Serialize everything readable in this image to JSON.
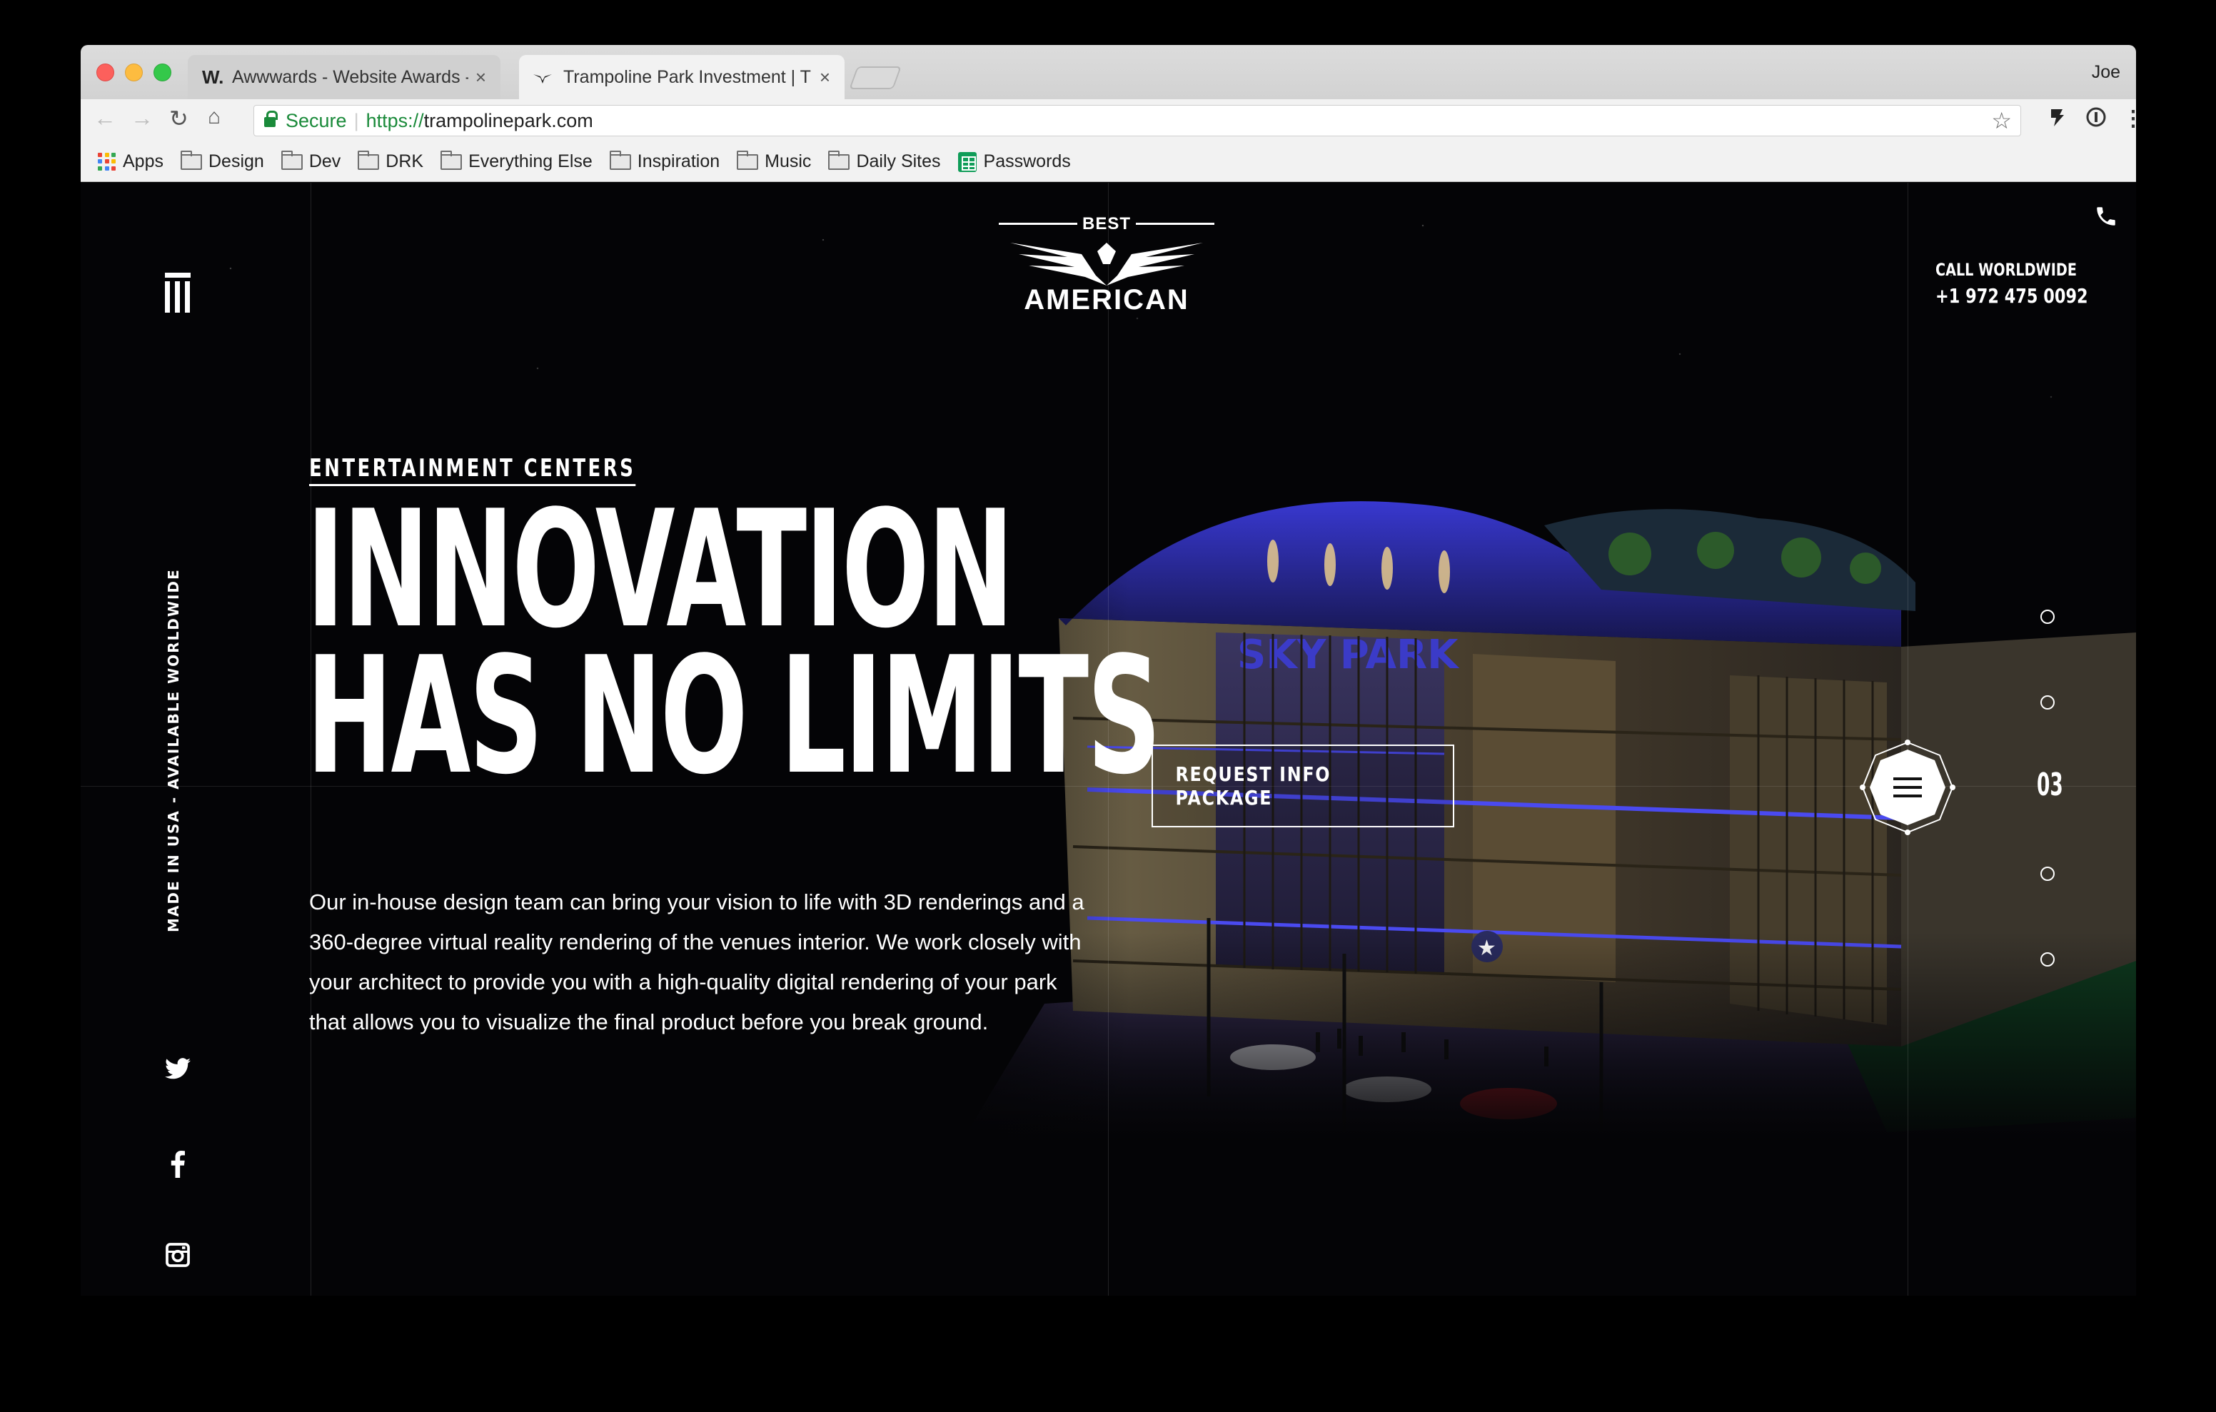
{
  "browser": {
    "tabs": [
      {
        "favicon": "W.",
        "title": "Awwwards - Website Awards -",
        "close": "×"
      },
      {
        "favicon": "eagle-icon",
        "title": "Trampoline Park Investment | T",
        "close": "×"
      }
    ],
    "profile": "Joe",
    "address": {
      "secure_label": "Secure",
      "scheme": "https://",
      "host": "trampolinepark.com"
    },
    "bookmarks": [
      {
        "label": "Apps",
        "icon": "apps-grid-icon"
      },
      {
        "label": "Design",
        "icon": "folder-icon"
      },
      {
        "label": "Dev",
        "icon": "folder-icon"
      },
      {
        "label": "DRK",
        "icon": "folder-icon"
      },
      {
        "label": "Everything Else",
        "icon": "folder-icon"
      },
      {
        "label": "Inspiration",
        "icon": "folder-icon"
      },
      {
        "label": "Music",
        "icon": "folder-icon"
      },
      {
        "label": "Daily Sites",
        "icon": "folder-icon"
      },
      {
        "label": "Passwords",
        "icon": "sheets-icon"
      }
    ]
  },
  "site": {
    "logo": {
      "top": "BEST",
      "name": "AMERICAN"
    },
    "side_text": "MADE IN USA - AVAILABLE WORLDWIDE",
    "eyebrow": "ENTERTAINMENT CENTERS",
    "headline": {
      "line1": "INNOVATION",
      "line2": "HAS NO LIMITS"
    },
    "body": "Our in-house design team can bring your vision to life with 3D renderings and a 360-degree virtual reality rendering of the venues interior. We work closely with your architect to provide you with a high-quality digital rendering of your park that allows you to visualize the final product before you break ground.",
    "cta": "REQUEST INFO PACKAGE",
    "call_label": "CALL WORLDWIDE",
    "call_number": "+1 972 475 0092",
    "slide_number": "03",
    "building_sign": "SKY PARK",
    "colors": {
      "background": "#040406",
      "accent_blue": "#3a3ad8",
      "text": "#ffffff"
    }
  }
}
